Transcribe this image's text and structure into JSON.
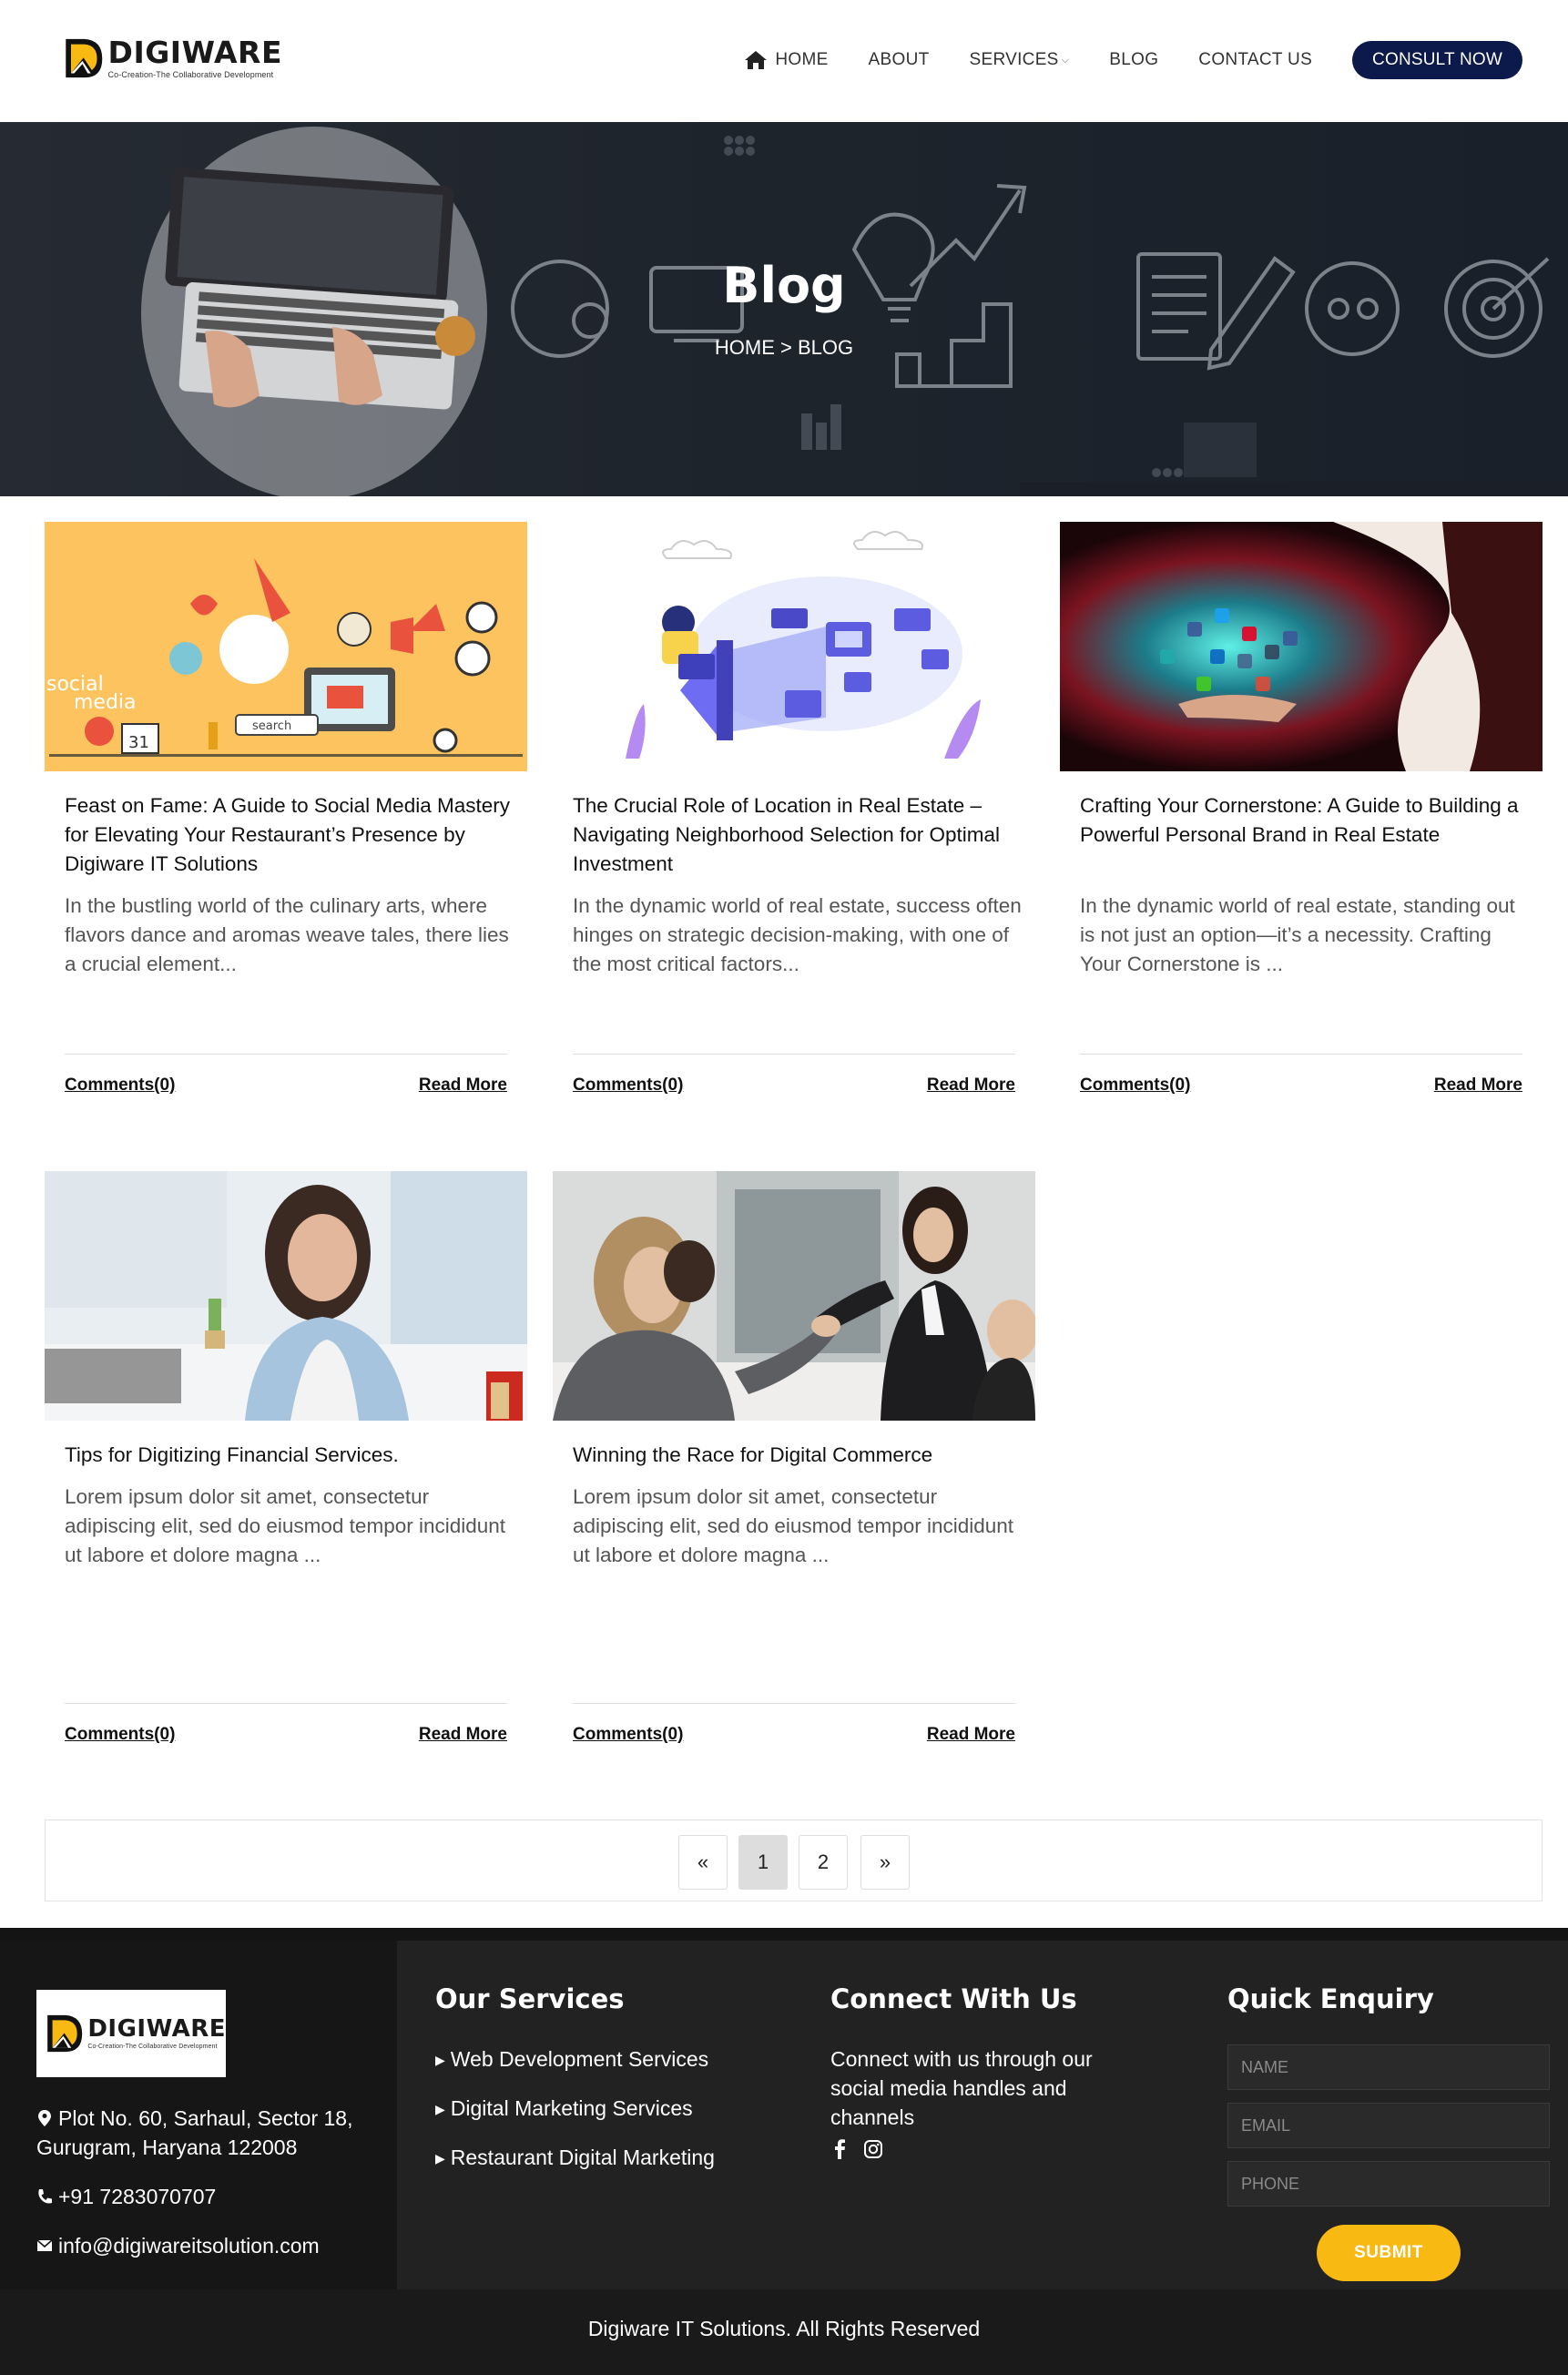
{
  "brand": {
    "name": "DIGIWARE",
    "tagline": "Co-Creation-The Collaborative Development",
    "accent": "#f9b913",
    "navy": "#0b1a4a"
  },
  "nav": {
    "items": [
      "HOME",
      "ABOUT",
      "SERVICES",
      "BLOG",
      "CONTACT US"
    ],
    "cta": "CONSULT NOW",
    "home_icon": "home-icon",
    "services_chevron": "chevron-down-icon"
  },
  "hero": {
    "title": "Blog",
    "breadcrumb": "HOME > BLOG"
  },
  "posts": [
    {
      "title": "Feast on Fame: A Guide to Social Media Mastery for Elevating Your Restaurant’s Presence by Digiware IT Solutions",
      "excerpt": "In the bustling world of the culinary arts, where flavors dance and aromas weave tales, there lies a crucial element...",
      "comments": "Comments(0)",
      "read_more": "Read More",
      "image_text_1": "social",
      "image_text_2": "media",
      "image_text_3": "search",
      "image_text_4": "31"
    },
    {
      "title": "The Crucial Role of Location in Real Estate – Navigating Neighborhood Selection for Optimal Investment",
      "excerpt": "In the dynamic world of real estate, success often hinges on strategic decision-making, with one of the most critical factors...",
      "comments": "Comments(0)",
      "read_more": "Read More"
    },
    {
      "title": "Crafting Your Cornerstone: A Guide to Building a Powerful Personal Brand in Real Estate",
      "excerpt": "In the dynamic world of real estate, standing out is not just an option—it’s a necessity. Crafting Your Cornerstone is ...",
      "comments": "Comments(0)",
      "read_more": "Read More"
    },
    {
      "title": "Tips for Digitizing Financial Services.",
      "excerpt": "Lorem ipsum dolor sit amet, consectetur adipiscing elit, sed do eiusmod tempor incididunt ut labore et dolore magna ...",
      "comments": "Comments(0)",
      "read_more": "Read More"
    },
    {
      "title": "Winning the Race for Digital Commerce",
      "excerpt": "Lorem ipsum dolor sit amet, consectetur adipiscing elit, sed do eiusmod tempor incididunt ut labore et dolore magna ...",
      "comments": "Comments(0)",
      "read_more": "Read More"
    }
  ],
  "pagination": {
    "prev": "«",
    "pages": [
      "1",
      "2"
    ],
    "current": "1",
    "next": "»"
  },
  "footer": {
    "address": "Plot No. 60, Sarhaul, Sector 18, Gurugram, Haryana 122008",
    "phone": "+91 7283070707",
    "email": "info@digiwareitsolution.com",
    "services_heading": "Our Services",
    "services": [
      "Web Development Services",
      "Digital Marketing Services",
      "Restaurant Digital Marketing"
    ],
    "connect_heading": "Connect With Us",
    "connect_text": "Connect with us through our social media handles and channels",
    "social_icons": [
      "facebook-icon",
      "instagram-icon"
    ],
    "enquiry_heading": "Quick Enquiry",
    "name_placeholder": "NAME",
    "email_placeholder": "EMAIL",
    "phone_placeholder": "PHONE",
    "submit": "SUBMIT",
    "copyright": "Digiware IT Solutions. All Rights Reserved"
  }
}
